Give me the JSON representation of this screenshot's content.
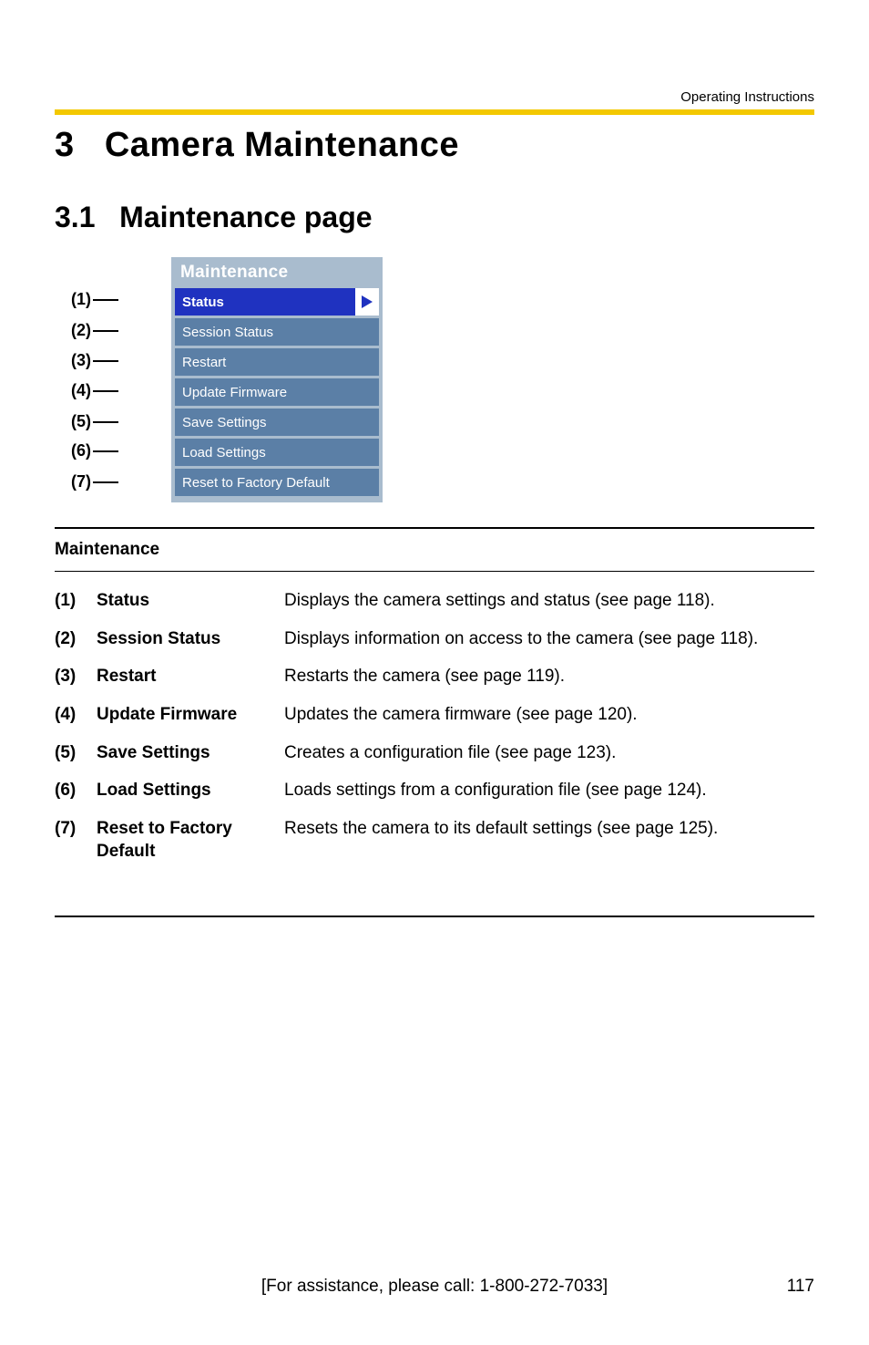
{
  "header": {
    "right_text": "Operating Instructions"
  },
  "h1": {
    "number": "3",
    "title": "Camera Maintenance"
  },
  "h2": {
    "number": "3.1",
    "title": "Maintenance page"
  },
  "menu": {
    "title": "Maintenance",
    "callouts": [
      "(1)",
      "(2)",
      "(3)",
      "(4)",
      "(5)",
      "(6)",
      "(7)"
    ],
    "items": [
      {
        "label": "Status",
        "selected": true
      },
      {
        "label": "Session Status",
        "selected": false
      },
      {
        "label": "Restart",
        "selected": false
      },
      {
        "label": "Update Firmware",
        "selected": false
      },
      {
        "label": "Save Settings",
        "selected": false
      },
      {
        "label": "Load Settings",
        "selected": false
      },
      {
        "label": "Reset to Factory Default",
        "selected": false
      }
    ]
  },
  "table": {
    "header": "Maintenance",
    "rows": [
      {
        "num": "(1)",
        "name": "Status",
        "desc": "Displays the camera settings and status (see page 118)."
      },
      {
        "num": "(2)",
        "name": "Session Status",
        "desc": "Displays information on access to the camera (see page 118)."
      },
      {
        "num": "(3)",
        "name": "Restart",
        "desc": "Restarts the camera (see page 119)."
      },
      {
        "num": "(4)",
        "name": "Update Firmware",
        "desc": "Updates the camera firmware (see page 120)."
      },
      {
        "num": "(5)",
        "name": "Save Settings",
        "desc": "Creates a configuration file (see page 123)."
      },
      {
        "num": "(6)",
        "name": "Load Settings",
        "desc": "Loads settings from a configuration file (see page 124)."
      },
      {
        "num": "(7)",
        "name": "Reset to Factory Default",
        "desc": "Resets the camera to its default settings (see page 125)."
      }
    ]
  },
  "footer": {
    "assist": "[For assistance, please call: 1-800-272-7033]",
    "page": "117"
  }
}
